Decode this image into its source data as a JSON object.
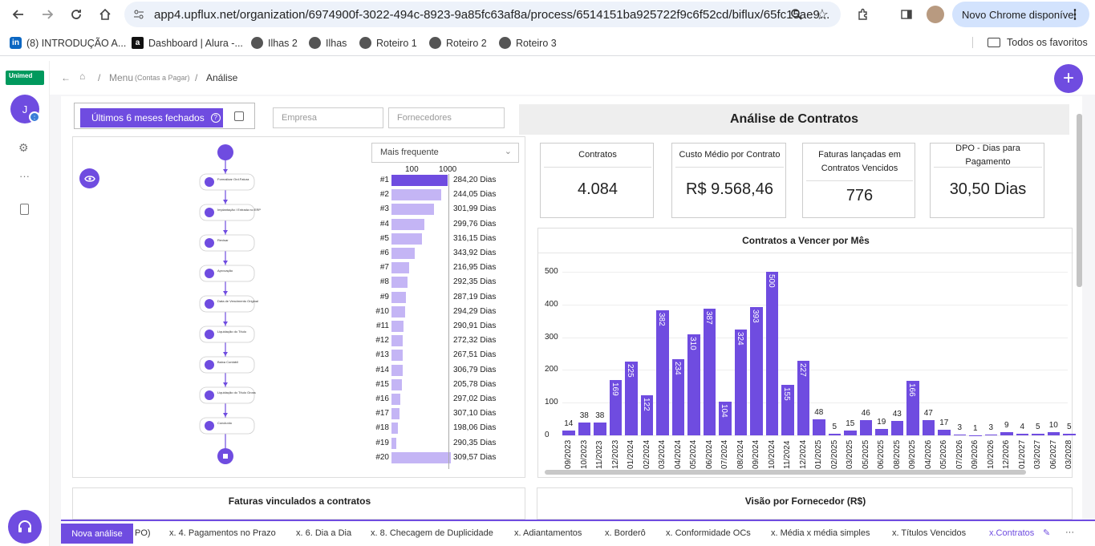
{
  "browser": {
    "url": "app4.upflux.net/organization/6974900f-3022-494c-8923-9a85fc63af8a/process/6514151ba925722f9c6f52cd/biflux/65fc15ae9...",
    "new_chrome": "Novo Chrome disponível",
    "bookmarks": [
      "(8) INTRODUÇÃO A...",
      "Dashboard | Alura -...",
      "Ilhas 2",
      "Ilhas",
      "Roteiro 1",
      "Roteiro 2",
      "Roteiro 3"
    ],
    "all_bookmarks": "Todos os favoritos"
  },
  "app": {
    "logo_text": "Unimed",
    "avatar_initial": "J",
    "breadcrumb": {
      "menu": "Menu",
      "menu_sub": "(Contas a Pagar)",
      "sep": "/",
      "current": "Análise"
    },
    "add_icon": "+"
  },
  "filters": {
    "period_label": "Últimos 6 meses fechados",
    "empresa_placeholder": "Empresa",
    "fornecedores_placeholder": "Fornecedores"
  },
  "header_title": "Análise de Contratos",
  "process": {
    "nodes": [
      "Formalizar Ord.Fatura",
      "Implantação / Entrada no ERP",
      "Revisar",
      "Aprovação",
      "Data de Vencimento Original",
      "Liquidação do Título",
      "Baixa Contábil",
      "Liquidação do Título Gross",
      "Concluído"
    ],
    "sort_select": "Mais frequente",
    "scale": [
      "100",
      "1000"
    ],
    "ranks": [
      "#1",
      "#2",
      "#3",
      "#4",
      "#5",
      "#6",
      "#7",
      "#8",
      "#9",
      "#10",
      "#11",
      "#12",
      "#13",
      "#14",
      "#15",
      "#16",
      "#17",
      "#18",
      "#19",
      "#20"
    ],
    "durations": [
      "284,20 Dias",
      "244,05 Dias",
      "301,99 Dias",
      "299,76 Dias",
      "316,15 Dias",
      "343,92 Dias",
      "216,95 Dias",
      "292,35 Dias",
      "287,19 Dias",
      "294,29 Dias",
      "290,91 Dias",
      "272,32 Dias",
      "267,51 Dias",
      "306,79 Dias",
      "205,78 Dias",
      "297,02 Dias",
      "307,10 Dias",
      "198,06 Dias",
      "290,35 Dias",
      "309,57 Dias"
    ],
    "bar_fractions": [
      1.0,
      0.88,
      0.76,
      0.58,
      0.54,
      0.42,
      0.32,
      0.28,
      0.26,
      0.24,
      0.22,
      0.2,
      0.2,
      0.2,
      0.18,
      0.16,
      0.14,
      0.12,
      0.08,
      1.05
    ]
  },
  "kpis": [
    {
      "label": "Contratos",
      "value": "4.084"
    },
    {
      "label": "Custo Médio por Contrato",
      "value": "R$ 9.568,46"
    },
    {
      "label": "Faturas lançadas em Contratos Vencidos",
      "value": "776"
    },
    {
      "label": "DPO - Dias para Pagamento",
      "value": "30,50 Dias"
    }
  ],
  "chart_data": {
    "type": "bar",
    "title": "Contratos a Vencer por Mês",
    "categories": [
      "09/2023",
      "10/2023",
      "11/2023",
      "12/2023",
      "01/2024",
      "02/2024",
      "03/2024",
      "04/2024",
      "05/2024",
      "06/2024",
      "07/2024",
      "08/2024",
      "09/2024",
      "10/2024",
      "11/2024",
      "12/2024",
      "01/2025",
      "02/2025",
      "03/2025",
      "05/2025",
      "06/2025",
      "08/2025",
      "09/2025",
      "04/2026",
      "05/2026",
      "07/2026",
      "09/2026",
      "10/2026",
      "12/2026",
      "01/2027",
      "03/2027",
      "06/2027",
      "03/2028"
    ],
    "values": [
      14,
      38,
      38,
      169,
      225,
      122,
      382,
      234,
      310,
      387,
      104,
      324,
      393,
      500,
      155,
      227,
      48,
      5,
      15,
      46,
      19,
      43,
      166,
      47,
      17,
      3,
      1,
      3,
      9,
      4,
      5,
      10,
      5
    ],
    "ylim": [
      0,
      500
    ],
    "yticks": [
      0,
      100,
      200,
      300,
      400,
      500
    ],
    "color": "#6f4ce0"
  },
  "bottom_cards": {
    "left": "Faturas vinculados a contratos",
    "right": "Visão por Fornecedor (R$)"
  },
  "tabs": {
    "new": "Nova análise",
    "partial": "PO)",
    "items": [
      "x. 4. Pagamentos no Prazo",
      "x. 6. Dia a Dia",
      "x. 8. Checagem de Duplicidade",
      "x. Adiantamentos",
      "x. Borderô",
      "x. Conformidade OCs",
      "x. Média x média simples",
      "x. Títulos Vencidos",
      "x.Contratos"
    ],
    "more": "···"
  },
  "colors": {
    "accent": "#6f4ce0",
    "bar_light": "#c4b5f5"
  }
}
